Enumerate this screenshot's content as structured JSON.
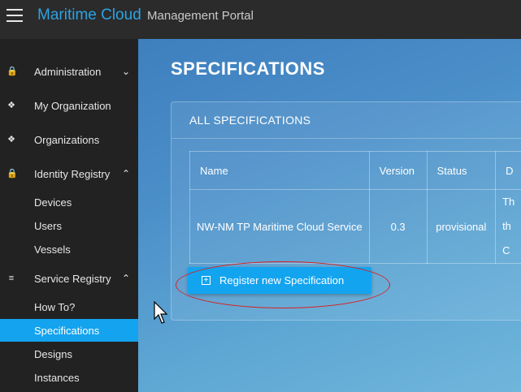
{
  "topbar": {
    "brand": "Maritime Cloud",
    "subtitle": "Management Portal"
  },
  "sidebar": {
    "items": [
      {
        "label": "Administration",
        "icon": "lock-icon",
        "expanded": false
      },
      {
        "label": "My Organization",
        "icon": "group-icon"
      },
      {
        "label": "Organizations",
        "icon": "group-icon"
      },
      {
        "label": "Identity Registry",
        "icon": "lock-icon",
        "expanded": true
      },
      {
        "label": "Devices"
      },
      {
        "label": "Users"
      },
      {
        "label": "Vessels"
      },
      {
        "label": "Service Registry",
        "icon": "layers-icon",
        "expanded": true
      },
      {
        "label": "How To?"
      },
      {
        "label": "Specifications",
        "active": true
      },
      {
        "label": "Designs"
      },
      {
        "label": "Instances"
      }
    ]
  },
  "main": {
    "title": "SPECIFICATIONS",
    "panel_title": "ALL SPECIFICATIONS",
    "table": {
      "headers": [
        "Name",
        "Version",
        "Status",
        "D"
      ],
      "rows": [
        {
          "name": "NW-NM TP Maritime Cloud Service",
          "version": "0.3",
          "status": "provisional",
          "desc_lines": [
            "Th",
            "th",
            "C"
          ]
        }
      ]
    },
    "register_button": "Register new Specification"
  },
  "colors": {
    "brand": "#2ba3e3",
    "active": "#14a3ee",
    "annotation": "#d8201f"
  }
}
